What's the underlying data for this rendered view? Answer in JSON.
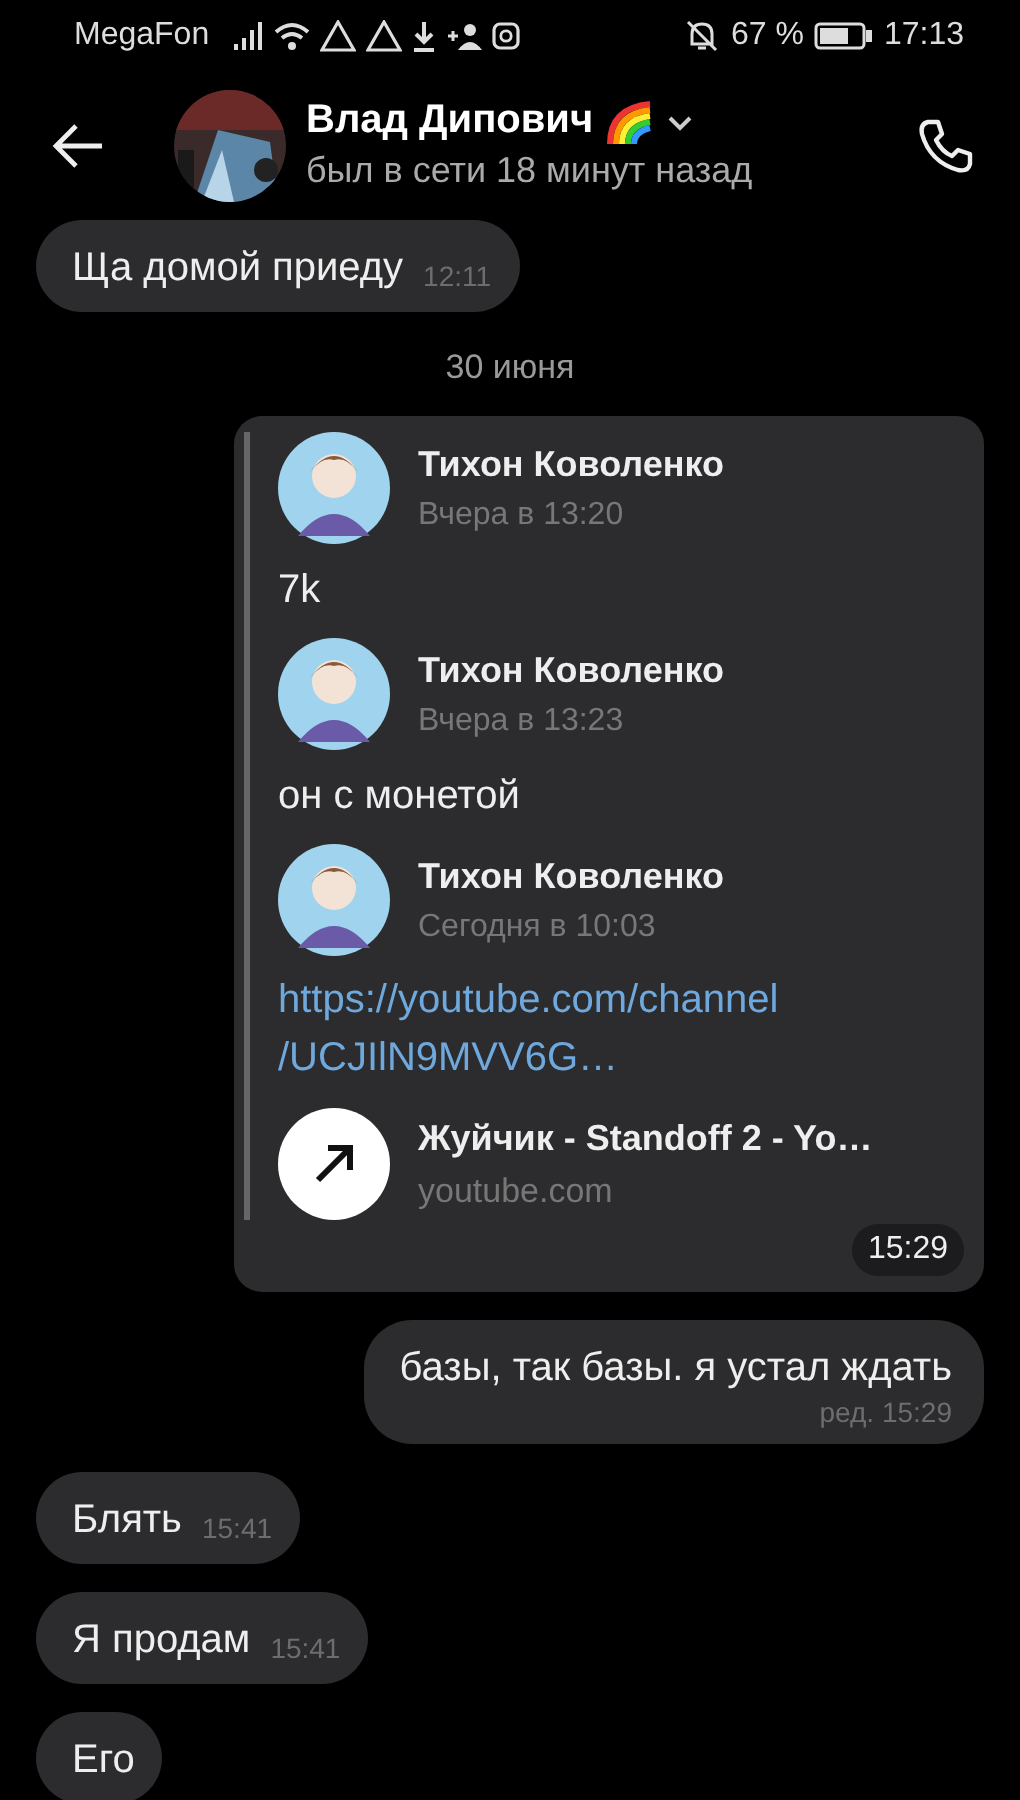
{
  "status_bar": {
    "carrier": "MegaFon",
    "battery": "67 %",
    "time": "17:13"
  },
  "header": {
    "name": "Влад Дипович",
    "status": "был в сети 18 минут назад"
  },
  "messages": [
    {
      "kind": "incoming",
      "text": "Ща домой приеду",
      "time": "12:11"
    },
    {
      "kind": "date",
      "text": "30 июня"
    },
    {
      "kind": "forwarded",
      "time": "15:29",
      "posts": [
        {
          "author": "Тихон Коволенко",
          "time": "Вчера в 13:20",
          "text": "7k"
        },
        {
          "author": "Тихон Коволенко",
          "time": "Вчера в 13:23",
          "text": "он с монетой"
        },
        {
          "author": "Тихон Коволенко",
          "time": "Сегодня в 10:03",
          "link": [
            "https://youtube.com/channel",
            "/UCJIlN9MVV6G…"
          ],
          "preview": {
            "title": "Жуйчик - Standoff 2 - Yo…",
            "domain": "youtube.com"
          }
        }
      ]
    },
    {
      "kind": "outgoing",
      "text": "базы, так базы. я устал ждать",
      "time": "ред. 15:29"
    },
    {
      "kind": "incoming",
      "text": "Блять",
      "time": "15:41"
    },
    {
      "kind": "incoming",
      "text": "Я продам",
      "time": "15:41"
    },
    {
      "kind": "incoming",
      "text": "Его"
    }
  ]
}
